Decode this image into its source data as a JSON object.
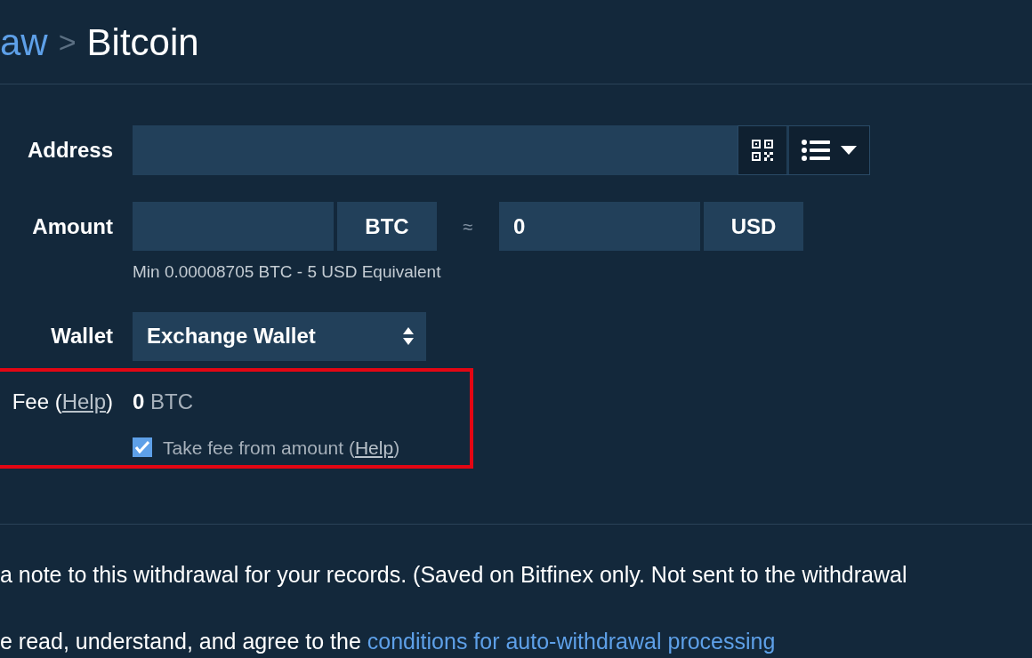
{
  "breadcrumb": {
    "parent": "aw",
    "separator": ">",
    "current": "Bitcoin"
  },
  "address": {
    "label": "Address"
  },
  "amount": {
    "label": "Amount",
    "currency": "BTC",
    "approx": "≈",
    "usd_value": "0",
    "usd_currency": "USD",
    "hint": "Min 0.00008705 BTC - 5 USD Equivalent"
  },
  "wallet": {
    "label": "Wallet",
    "value": "Exchange Wallet"
  },
  "fee": {
    "label": "Fee",
    "help_open": "(",
    "help": "Help",
    "help_close": ")",
    "amount": "0",
    "unit": "BTC",
    "highlighted": true,
    "take_fee": {
      "label": "Take fee from amount",
      "help_open": "(",
      "help": "Help",
      "help_close": ")",
      "checked": true
    }
  },
  "note": "a note to this withdrawal for your records. (Saved on Bitfinex only. Not sent to the withdrawal",
  "agree": {
    "text": "e read, understand, and agree to the",
    "link": "conditions for auto-withdrawal processing"
  }
}
